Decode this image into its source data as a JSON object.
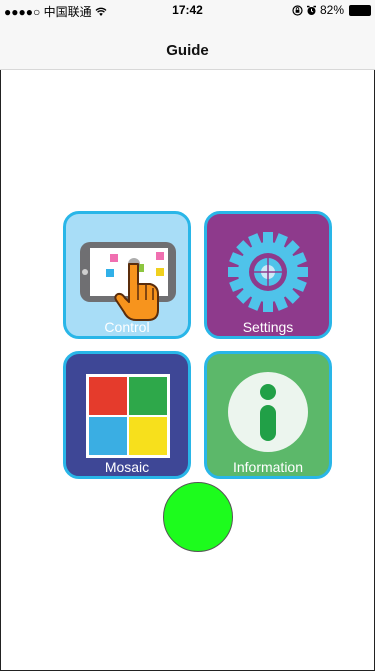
{
  "status_bar": {
    "carrier": "●●●●○ 中国联通",
    "wifi_icon": "wifi-icon",
    "time": "17:42",
    "battery": "82%"
  },
  "nav": {
    "title": "Guide"
  },
  "tiles": [
    {
      "label": "Control",
      "icon": "tablet-touch-icon",
      "color": "#a8ddf7"
    },
    {
      "label": "Settings",
      "icon": "gear-icon",
      "color": "#8e3a8c"
    },
    {
      "label": "Mosaic",
      "icon": "mosaic-icon",
      "color": "#3e4796"
    },
    {
      "label": "Information",
      "icon": "info-icon",
      "color": "#5cb86a"
    }
  ],
  "colors": {
    "tile_border": "#29b6e8",
    "circle": "#1dfc1d",
    "mosaic": [
      "#e53b2c",
      "#2ea84a",
      "#3aaee3",
      "#f7e01c"
    ]
  }
}
